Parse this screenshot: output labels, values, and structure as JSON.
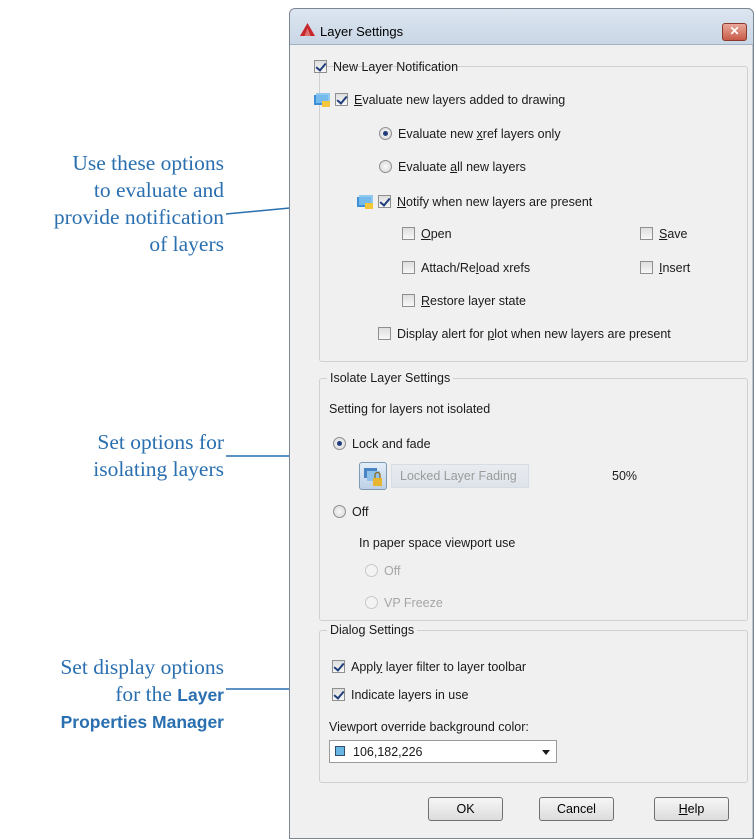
{
  "callouts": {
    "notification": [
      "Use these options",
      "to evaluate and",
      "provide notification",
      "of layers"
    ],
    "isolate": [
      "Set options for",
      "isolating layers"
    ],
    "display_line1": "Set display options",
    "display_line2_prefix": "for the ",
    "display_line2_bold": "Layer",
    "display_line3_bold": "Properties Manager"
  },
  "dialog": {
    "title": "Layer Settings",
    "close_glyph": "✕",
    "new_layer_notification": {
      "label": "New Layer Notification",
      "checked": true,
      "evaluate": {
        "mn": "E",
        "rest": "valuate new layers added to drawing",
        "checked": true
      },
      "xref_only": {
        "pre": "Evaluate new ",
        "mn": "x",
        "post": "ref layers only",
        "selected": true
      },
      "all_new": {
        "pre": "Evaluate ",
        "mn": "a",
        "post": "ll new layers",
        "selected": false
      },
      "notify": {
        "mn": "N",
        "rest": "otify when new layers are present",
        "checked": true
      },
      "open": {
        "mn": "O",
        "rest": "pen",
        "checked": false
      },
      "save": {
        "mn": "S",
        "rest": "ave",
        "checked": false
      },
      "attach": {
        "pre": "Attach/Re",
        "mn": "l",
        "post": "oad xrefs",
        "checked": false
      },
      "insert": {
        "mn": "I",
        "rest": "nsert",
        "checked": false
      },
      "restore": {
        "mn": "R",
        "rest": "estore layer state",
        "checked": false
      },
      "plot_alert": {
        "pre": "Display alert for ",
        "mn": "p",
        "post": "lot when new layers are present",
        "checked": false
      }
    },
    "isolate": {
      "title": "Isolate Layer Settings",
      "subtitle": "Setting for layers not isolated",
      "lock_fade": "Lock and fade",
      "fading_label": "Locked Layer Fading",
      "fading_value": "50%",
      "off": "Off",
      "paper_space": "In paper space viewport use",
      "ps_off": "Off",
      "vp_freeze": "VP Freeze"
    },
    "dialog_settings": {
      "title": "Dialog Settings",
      "apply_filter": {
        "pre": "Appl",
        "mn": "y",
        "post": " layer filter to layer toolbar",
        "checked": true
      },
      "indicate": {
        "label": "Indicate layers in use",
        "checked": true
      },
      "bg_label": "Viewport override background color:",
      "bg_value": "106,182,226",
      "bg_swatch": "#6ab6e2"
    },
    "buttons": {
      "ok": "OK",
      "cancel": "Cancel",
      "help_mn": "H",
      "help_rest": "elp"
    }
  },
  "colors": {
    "callout": "#2a6fb0",
    "check": "#1f3d7a"
  }
}
